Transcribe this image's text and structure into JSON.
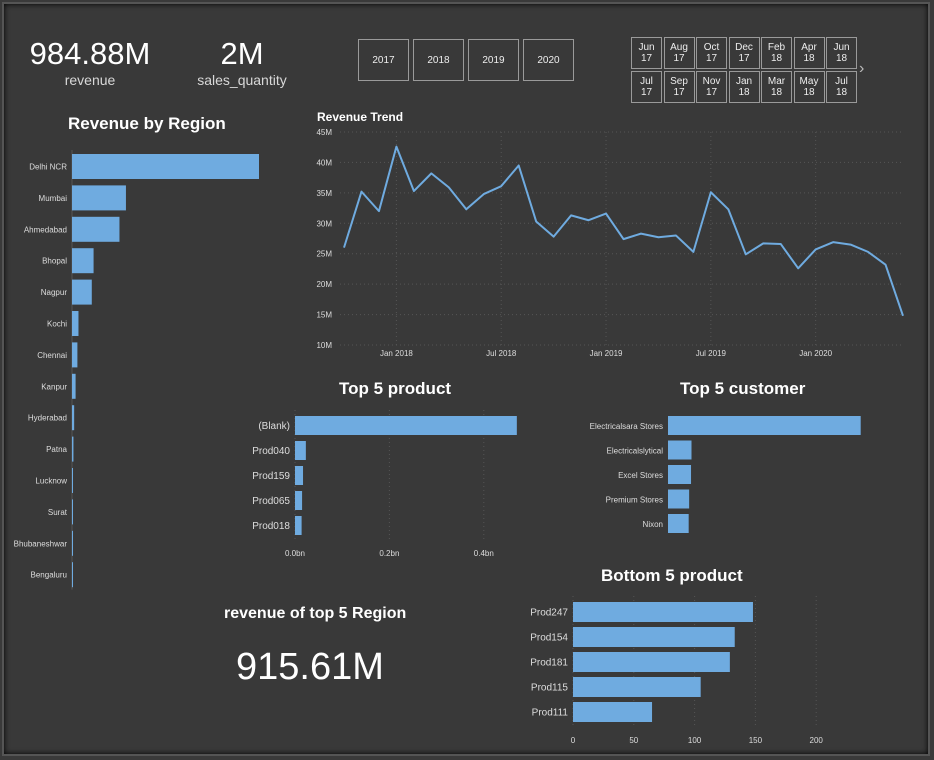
{
  "kpis": {
    "revenue_value": "984.88M",
    "revenue_label": "revenue",
    "quantity_value": "2M",
    "quantity_label": "sales_quantity"
  },
  "years": [
    "2017",
    "2018",
    "2019",
    "2020"
  ],
  "months_row1": [
    [
      "Jun",
      "17"
    ],
    [
      "Aug",
      "17"
    ],
    [
      "Oct",
      "17"
    ],
    [
      "Dec",
      "17"
    ],
    [
      "Feb",
      "18"
    ],
    [
      "Apr",
      "18"
    ],
    [
      "Jun",
      "18"
    ]
  ],
  "months_row2": [
    [
      "Jul",
      "17"
    ],
    [
      "Sep",
      "17"
    ],
    [
      "Nov",
      "17"
    ],
    [
      "Jan",
      "18"
    ],
    [
      "Mar",
      "18"
    ],
    [
      "May",
      "18"
    ],
    [
      "Jul",
      "18"
    ]
  ],
  "next_arrow": "›",
  "top5_region": {
    "title": "revenue of top 5 Region",
    "value": "915.61M"
  },
  "colors": {
    "bar": "#6fabe0",
    "line": "#6fabe0",
    "background": "#393939"
  },
  "chart_data": [
    {
      "id": "region",
      "type": "bar",
      "orientation": "horizontal",
      "title": "Revenue by Region",
      "categories": [
        "Delhi NCR",
        "Mumbai",
        "Ahmedabad",
        "Bhopal",
        "Nagpur",
        "Kochi",
        "Chennai",
        "Kanpur",
        "Hyderabad",
        "Patna",
        "Lucknow",
        "Surat",
        "Bhubaneshwar",
        "Bengaluru"
      ],
      "values": [
        520,
        150,
        132,
        60,
        55,
        18,
        15,
        10,
        6,
        4,
        2.5,
        1.5,
        0.8,
        0.4
      ]
    },
    {
      "id": "trend",
      "type": "line",
      "title": "Revenue Trend",
      "x": [
        "2017-10",
        "2017-11",
        "2017-12",
        "2018-01",
        "2018-02",
        "2018-03",
        "2018-04",
        "2018-05",
        "2018-06",
        "2018-07",
        "2018-08",
        "2018-09",
        "2018-10",
        "2018-11",
        "2018-12",
        "2019-01",
        "2019-02",
        "2019-03",
        "2019-04",
        "2019-05",
        "2019-06",
        "2019-07",
        "2019-08",
        "2019-09",
        "2019-10",
        "2019-11",
        "2019-12",
        "2020-01",
        "2020-02",
        "2020-03",
        "2020-04",
        "2020-05",
        "2020-06"
      ],
      "values": [
        26.0,
        35.2,
        32.0,
        42.6,
        35.3,
        38.2,
        35.9,
        32.3,
        34.8,
        36.1,
        39.5,
        30.3,
        27.8,
        31.3,
        30.5,
        31.6,
        27.4,
        28.3,
        27.7,
        28.0,
        25.3,
        35.1,
        32.3,
        24.9,
        26.7,
        26.6,
        22.6,
        25.7,
        26.9,
        26.5,
        25.3,
        23.2,
        14.8
      ],
      "ylim": [
        10,
        45
      ],
      "yticks": [
        "10M",
        "15M",
        "20M",
        "25M",
        "30M",
        "35M",
        "40M",
        "45M"
      ],
      "xticks": [
        {
          "label": "Jan 2018",
          "at": "2018-01"
        },
        {
          "label": "Jul 2018",
          "at": "2018-07"
        },
        {
          "label": "Jan 2019",
          "at": "2019-01"
        },
        {
          "label": "Jul 2019",
          "at": "2019-07"
        },
        {
          "label": "Jan 2020",
          "at": "2020-01"
        }
      ],
      "grid": true
    },
    {
      "id": "top5product",
      "type": "bar",
      "orientation": "horizontal",
      "title": "Top 5 product",
      "categories": [
        "(Blank)",
        "Prod040",
        "Prod159",
        "Prod065",
        "Prod018"
      ],
      "values": [
        0.47,
        0.023,
        0.017,
        0.015,
        0.014
      ],
      "xticks": [
        "0.0bn",
        "0.2bn",
        "0.4bn"
      ],
      "xtick_values": [
        0,
        0.2,
        0.4
      ],
      "xlim": [
        0,
        0.5
      ]
    },
    {
      "id": "top5customer",
      "type": "bar",
      "orientation": "horizontal",
      "title": "Top 5 customer",
      "categories": [
        "Electricalsara Stores",
        "Electricalslytical",
        "Excel Stores",
        "Premium Stores",
        "Nixon"
      ],
      "values": [
        0.41,
        0.05,
        0.049,
        0.045,
        0.044
      ],
      "xlim": [
        0,
        0.5
      ]
    },
    {
      "id": "bottom5product",
      "type": "bar",
      "orientation": "horizontal",
      "title": "Bottom 5 product",
      "categories": [
        "Prod247",
        "Prod154",
        "Prod181",
        "Prod115",
        "Prod111"
      ],
      "values": [
        148,
        133,
        129,
        105,
        65
      ],
      "xticks": [
        "0",
        "50",
        "100",
        "150",
        "200"
      ],
      "xtick_values": [
        0,
        50,
        100,
        150,
        200
      ],
      "xlim": [
        0,
        250
      ]
    }
  ]
}
